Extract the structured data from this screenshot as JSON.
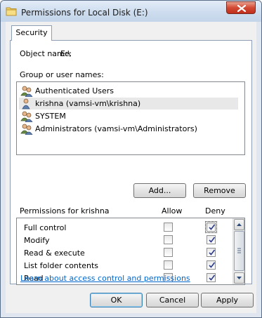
{
  "window": {
    "title": "Permissions for Local Disk (E:)"
  },
  "tab": {
    "label": "Security"
  },
  "object": {
    "label": "Object name:",
    "value": "E:\\"
  },
  "groups": {
    "label": "Group or user names:",
    "items": [
      {
        "label": "Authenticated Users",
        "icon": "user-group-icon",
        "selected": false
      },
      {
        "label": "krishna (vamsi-vm\\krishna)",
        "icon": "user-icon",
        "selected": true
      },
      {
        "label": "SYSTEM",
        "icon": "user-group-icon",
        "selected": false
      },
      {
        "label": "Administrators (vamsi-vm\\Administrators)",
        "icon": "user-group-icon",
        "selected": false
      }
    ]
  },
  "buttons": {
    "add": "Add...",
    "remove": "Remove",
    "ok": "OK",
    "cancel": "Cancel",
    "apply": "Apply"
  },
  "permissions": {
    "header": "Permissions for krishna",
    "allow_label": "Allow",
    "deny_label": "Deny",
    "rows": [
      {
        "name": "Full control",
        "allow": false,
        "deny": true
      },
      {
        "name": "Modify",
        "allow": false,
        "deny": true
      },
      {
        "name": "Read & execute",
        "allow": false,
        "deny": true
      },
      {
        "name": "List folder contents",
        "allow": false,
        "deny": true
      },
      {
        "name": "Read",
        "allow": false,
        "deny": true
      }
    ]
  },
  "link": {
    "text": "Learn about access control and permissions"
  },
  "colors": {
    "link": "#0066cc",
    "close_button": "#c9432c"
  }
}
